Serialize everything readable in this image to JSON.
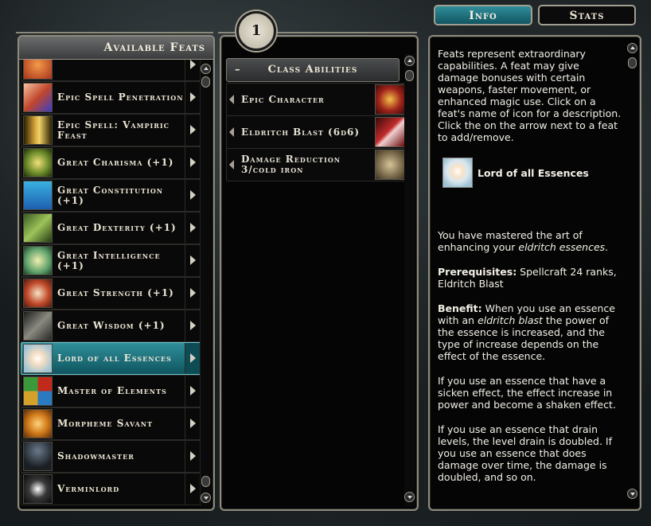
{
  "left": {
    "header": "Available Feats",
    "feats": [
      {
        "label": "",
        "partial": true
      },
      {
        "label": "Epic Spell Penetration"
      },
      {
        "label": "Epic Spell: Vampiric Feast"
      },
      {
        "label": "Great Charisma (+1)"
      },
      {
        "label": "Great Constitution (+1)"
      },
      {
        "label": "Great Dexterity (+1)"
      },
      {
        "label": "Great Intelligence (+1)"
      },
      {
        "label": "Great Strength (+1)"
      },
      {
        "label": "Great Wisdom (+1)"
      },
      {
        "label": "Lord of all Essences",
        "selected": true
      },
      {
        "label": "Master of Elements"
      },
      {
        "label": "Morpheme Savant"
      },
      {
        "label": "Shadowmaster"
      },
      {
        "label": "Verminlord"
      }
    ]
  },
  "middle": {
    "count": "1",
    "section_header": "Class Abilities",
    "section_toggle": "–",
    "abilities": [
      {
        "label": "Epic Character"
      },
      {
        "label": "Eldritch Blast (6d6)"
      },
      {
        "label": "Damage Reduction 3/cold iron"
      }
    ]
  },
  "tabs": {
    "info": "Info",
    "stats": "Stats"
  },
  "info": {
    "intro": "Feats represent extraordinary capabilities. A feat may give damage bonuses with certain weapons, faster movement, or enhanced magic use. Click on a feat's name of icon for a description. Click the on the arrow next to a feat to add/remove.",
    "feat_name": "Lord of all Essences",
    "desc_pre": "You have mastered the art of enhancing your ",
    "desc_em": "eldritch essences",
    "desc_post": ".",
    "prereq_label": "Prerequisites:",
    "prereq_text": " Spellcraft 24 ranks, Eldritch Blast",
    "benefit_label": "Benefit:",
    "benefit_pre": " When you use an essence with an ",
    "benefit_em": "eldritch blast",
    "benefit_post": " the power of the essence is increased, and the type of increase depends on the effect of the essence.",
    "para_sicken": "If you use an essence that have a sicken effect, the effect increase in power and become a shaken effect.",
    "para_drain": "If you use an essence that drain levels, the level drain is doubled. If you use an essence that does damage over time, the damage is doubled, and so on."
  },
  "icons": [
    "epic-spell-penetration-icon",
    "vampiric-feast-icon",
    "great-charisma-icon",
    "great-constitution-icon",
    "great-dexterity-icon",
    "great-intelligence-icon",
    "great-strength-icon",
    "great-wisdom-icon",
    "lord-of-all-essences-icon",
    "master-of-elements-icon",
    "morpheme-savant-icon",
    "shadowmaster-icon",
    "verminlord-icon"
  ],
  "colors": {
    "accent_teal": "#2f8e9a",
    "panel_border": "#8e8a7c",
    "text": "#ede6d5"
  }
}
